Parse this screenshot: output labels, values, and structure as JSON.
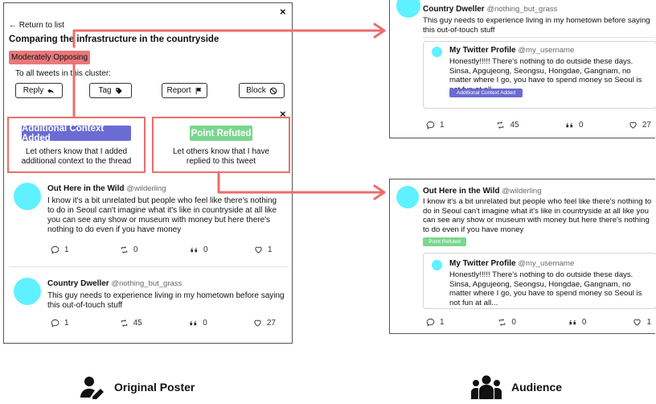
{
  "left_panel": {
    "close_label": "×",
    "return_label": "← Return to list",
    "title": "Comparing the infrastructure in the countryside",
    "stance_label": "Moderately Opposing",
    "cluster_label": "To all tweets in this cluster:",
    "buttons": {
      "reply": "Reply",
      "tag": "Tag",
      "report": "Report",
      "block": "Block"
    },
    "popup": {
      "close_label": "×",
      "context": {
        "badge": "Additional Context Added",
        "description": "Let others know that I added additional context to the thread"
      },
      "refuted": {
        "badge": "Point Refuted",
        "description": "Let others know that I have replied to this tweet"
      }
    },
    "tweets": [
      {
        "name": "Out Here in the Wild",
        "handle": "@wilderling",
        "text": "I know it's a bit unrelated but people who feel like there's nothing to do in Seoul can't imagine what it's like in countryside at all like you can see any show or museum with money but here there's nothing to do even if you have money",
        "replies": "1",
        "retweets": "0",
        "quotes": "0",
        "likes": "1"
      },
      {
        "name": "Country Dweller",
        "handle": "@nothing_but_grass",
        "text": "This guy needs to experience living in my hometown before saying this out-of-touch stuff",
        "replies": "1",
        "retweets": "45",
        "quotes": "0",
        "likes": "27"
      }
    ]
  },
  "right_top": {
    "name": "Country Dweller",
    "handle": "@nothing_but_grass",
    "text": "This guy needs to experience living in my hometown before saying this out-of-touch stuff",
    "quoted": {
      "name": "My Twitter Profile",
      "handle": "@my_username",
      "text": "Honestly!!!!! There's nothing to do outside these days. Sinsa, Apgujeong, Seongsu, Hongdae, Gangnam, no matter where I go, you have to spend money so Seoul is not fun at all...",
      "badge": "Additional Context Added"
    },
    "replies": "1",
    "retweets": "45",
    "quotes": "0",
    "likes": "27"
  },
  "right_bottom": {
    "name": "Out Here in the Wild",
    "handle": "@wilderling",
    "text": "I know it's a bit unrelated but people who feel like there's nothing to do in Seoul can't imagine what it's like in countryside at all like you can see any show or museum with money but here there's nothing to do even if you have money",
    "badge": "Point Refuted",
    "quoted": {
      "name": "My Twitter Profile",
      "handle": "@my_username",
      "text": "Honestly!!!!! There's nothing to do outside these days. Sinsa, Apgujeong, Seongsu, Hongdae, Gangnam, no matter where I go, you have to spend money so Seoul is not fun at all..."
    },
    "replies": "1",
    "retweets": "0",
    "quotes": "0",
    "likes": "1"
  },
  "captions": {
    "left": "Original Poster",
    "right": "Audience"
  },
  "colors": {
    "accent_red": "#ec6d6b",
    "context_purple": "#6b6bd4",
    "refuted_green": "#7bd68e",
    "avatar_cyan": "#5ff1ff",
    "stance_red": "#e7787a"
  }
}
